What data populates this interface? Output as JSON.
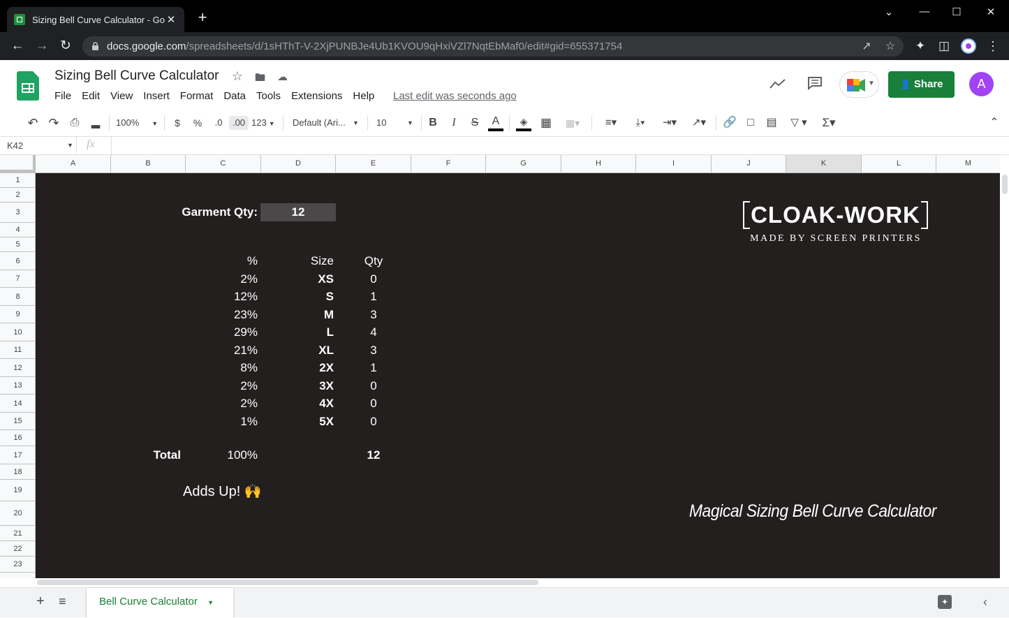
{
  "browser": {
    "tab_title": "Sizing Bell Curve Calculator - Goo",
    "tab_close": "✕",
    "new_tab": "+",
    "url_domain": "docs.google.com",
    "url_path": "/spreadsheets/d/1sHThT-V-2XjPUNBJe4Ub1KVOU9qHxiVZl7NqtEbMaf0/edit#gid=655371754",
    "window_controls": [
      "⌄",
      "—",
      "☐",
      "✕"
    ]
  },
  "doc": {
    "title": "Sizing Bell Curve Calculator",
    "menu": [
      "File",
      "Edit",
      "View",
      "Insert",
      "Format",
      "Data",
      "Tools",
      "Extensions",
      "Help"
    ],
    "last_edit": "Last edit was seconds ago",
    "share_label": "Share",
    "avatar_letter": "A",
    "accent_color": "#188038"
  },
  "toolbar": {
    "zoom": "100%",
    "currency": "$",
    "percent": "%",
    "dec_decrease": ".0",
    "dec_increase": ".00",
    "number_format": "123",
    "font": "Default (Ari...",
    "font_size": "10",
    "bold": "B",
    "italic": "I",
    "strike": "S",
    "text_color": "A"
  },
  "formula_bar": {
    "name_box": "K42",
    "fx": "fx"
  },
  "grid": {
    "columns": [
      "A",
      "B",
      "C",
      "D",
      "E",
      "F",
      "G",
      "H",
      "I",
      "J",
      "K",
      "L",
      "M"
    ],
    "selected_column": "K",
    "rows": [
      "1",
      "2",
      "3",
      "4",
      "5",
      "6",
      "7",
      "8",
      "9",
      "10",
      "11",
      "12",
      "13",
      "14",
      "15",
      "16",
      "17",
      "18",
      "19",
      "20",
      "21",
      "22",
      "23"
    ],
    "background": "#231f1f"
  },
  "calculator": {
    "qty_label": "Garment Qty:",
    "qty_value": "12",
    "headers": {
      "percent": "%",
      "size": "Size",
      "qty": "Qty"
    },
    "rows": [
      {
        "percent": "2%",
        "size": "XS",
        "qty": "0"
      },
      {
        "percent": "12%",
        "size": "S",
        "qty": "1"
      },
      {
        "percent": "23%",
        "size": "M",
        "qty": "3"
      },
      {
        "percent": "29%",
        "size": "L",
        "qty": "4"
      },
      {
        "percent": "21%",
        "size": "XL",
        "qty": "3"
      },
      {
        "percent": "8%",
        "size": "2X",
        "qty": "1"
      },
      {
        "percent": "2%",
        "size": "3X",
        "qty": "0"
      },
      {
        "percent": "2%",
        "size": "4X",
        "qty": "0"
      },
      {
        "percent": "1%",
        "size": "5X",
        "qty": "0"
      }
    ],
    "total_label": "Total",
    "total_percent": "100%",
    "total_qty": "12",
    "status": "Adds Up! 🙌"
  },
  "branding": {
    "logo_text": "CLOAK-WORK",
    "logo_tagline": "MADE BY SCREEN PRINTERS",
    "caption": "Magical Sizing Bell Curve Calculator"
  },
  "sheet_tabs": {
    "active": "Bell Curve Calculator"
  }
}
